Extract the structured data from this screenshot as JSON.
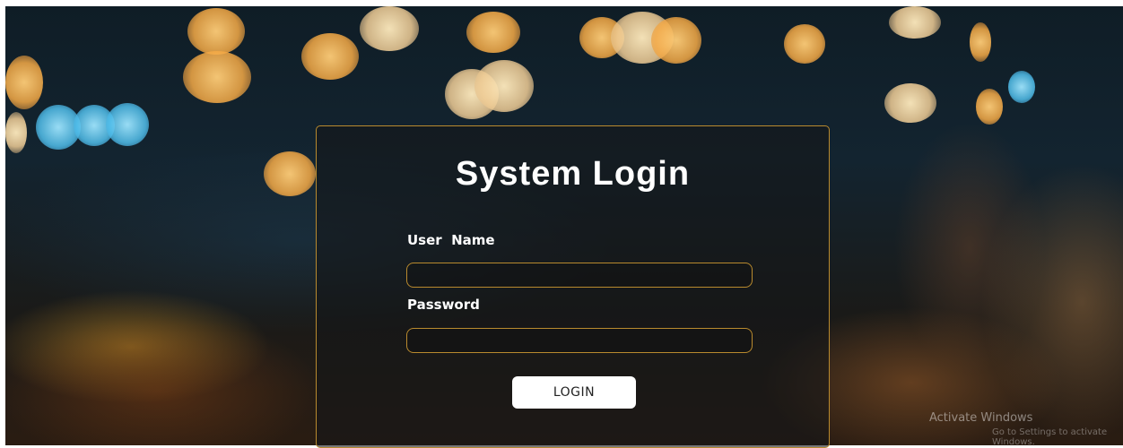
{
  "login": {
    "title": "System Login",
    "username_label": "User  Name",
    "username_value": "",
    "password_label": "Password",
    "password_value": "",
    "login_button": "LOGIN"
  },
  "watermark": {
    "line1": "Activate Windows",
    "line2": "Go to Settings to activate Windows."
  },
  "colors": {
    "panel_border": "#b98a2e",
    "button_bg": "#ffffff",
    "title_text": "#ffffff"
  }
}
